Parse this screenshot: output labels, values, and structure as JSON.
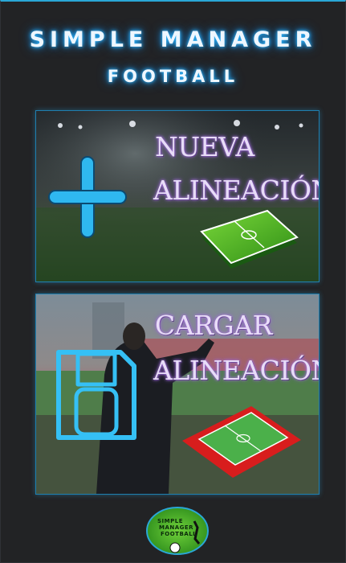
{
  "app": {
    "title_line1": "SIMPLE MANAGER",
    "title_line2": "FOOTBALL"
  },
  "actions": {
    "new_lineup": {
      "line1": "NUEVA",
      "line2": "ALINEACIÓN",
      "icon": "plus-icon"
    },
    "load_lineup": {
      "line1": "CARGAR",
      "line2": "ALINEACIÓN",
      "icon": "floppy-disk-icon"
    }
  },
  "logo": {
    "line1": "SIMPLE",
    "line2": "MANAGER",
    "line3": "FOOTBALL"
  },
  "colors": {
    "accent": "#2aa7d6",
    "background": "#222325",
    "label": "#e8dcf8"
  }
}
